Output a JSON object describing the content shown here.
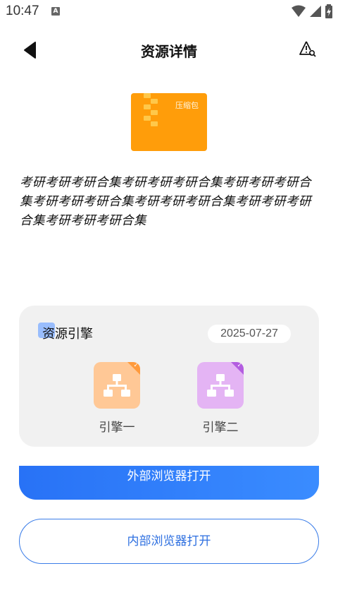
{
  "status_bar": {
    "time": "10:47",
    "notification_letter": "A",
    "icons": [
      "wifi-icon",
      "signal-icon",
      "battery-charging-icon"
    ]
  },
  "nav": {
    "title": "资源详情",
    "back_icon": "back-arrow-icon",
    "report_icon": "warning-report-icon"
  },
  "resource": {
    "thumbnail_label": "压缩包",
    "thumbnail_color": "#ff9d0a",
    "description": "考研考研考研合集考研考研考研合集考研考研考研合集考研考研考研合集考研考研考研合集考研考研考研合集考研考研考研合集"
  },
  "engine_card": {
    "title": "资源引擎",
    "date": "2025-07-27",
    "engines": [
      {
        "label": "引擎一",
        "color": "#ffc896",
        "corner_color": "#ff9a3c",
        "icon": "sitemap-icon"
      },
      {
        "label": "引擎二",
        "color": "#e4b4f4",
        "corner_color": "#b35de0",
        "icon": "sitemap-icon"
      }
    ]
  },
  "actions": {
    "external_browser": "外部浏览器打开",
    "internal_browser": "内部浏览器打开"
  }
}
